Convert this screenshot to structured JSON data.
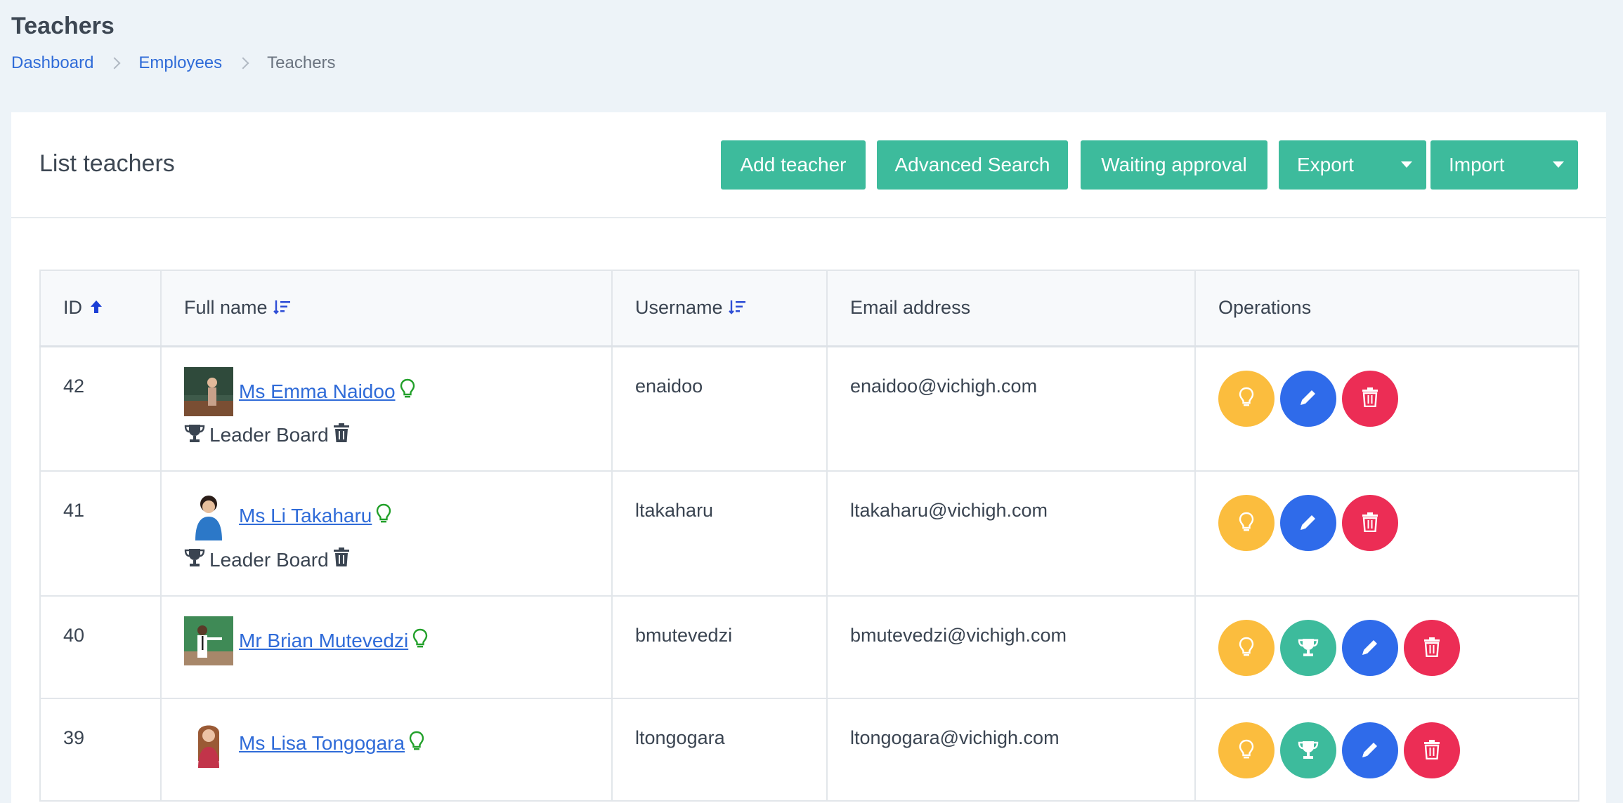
{
  "page": {
    "title": "Teachers",
    "breadcrumb": [
      "Dashboard",
      "Employees",
      "Teachers"
    ]
  },
  "card": {
    "title": "List teachers",
    "buttons": {
      "add": "Add teacher",
      "advanced": "Advanced Search",
      "waiting": "Waiting approval",
      "export": "Export",
      "import": "Import"
    }
  },
  "table": {
    "headers": {
      "id": "ID",
      "full_name": "Full name",
      "username": "Username",
      "email": "Email address",
      "operations": "Operations"
    },
    "rows": [
      {
        "id": "42",
        "name": "Ms Emma Naidoo",
        "username": "enaidoo",
        "email": "enaidoo@vichigh.com",
        "leader": "Leader Board"
      },
      {
        "id": "41",
        "name": "Ms Li Takaharu",
        "username": "ltakaharu",
        "email": "ltakaharu@vichigh.com",
        "leader": "Leader Board"
      },
      {
        "id": "40",
        "name": "Mr Brian Mutevedzi",
        "username": "bmutevedzi",
        "email": "bmutevedzi@vichigh.com"
      },
      {
        "id": "39",
        "name": "Ms Lisa Tongogara",
        "username": "ltongogara",
        "email": "ltongogara@vichigh.com"
      }
    ]
  },
  "colors": {
    "accent": "#3dbb9c",
    "link": "#2f6bd8",
    "yellow": "#fbbd3e",
    "blue": "#2f6bea",
    "red": "#ec2d55"
  },
  "icons": {
    "sort_asc": "arrow-up-icon",
    "sort": "sort-lines-icon",
    "bulb": "lightbulb-icon",
    "trophy": "trophy-icon",
    "pencil": "pencil-icon",
    "trash": "trash-icon"
  }
}
